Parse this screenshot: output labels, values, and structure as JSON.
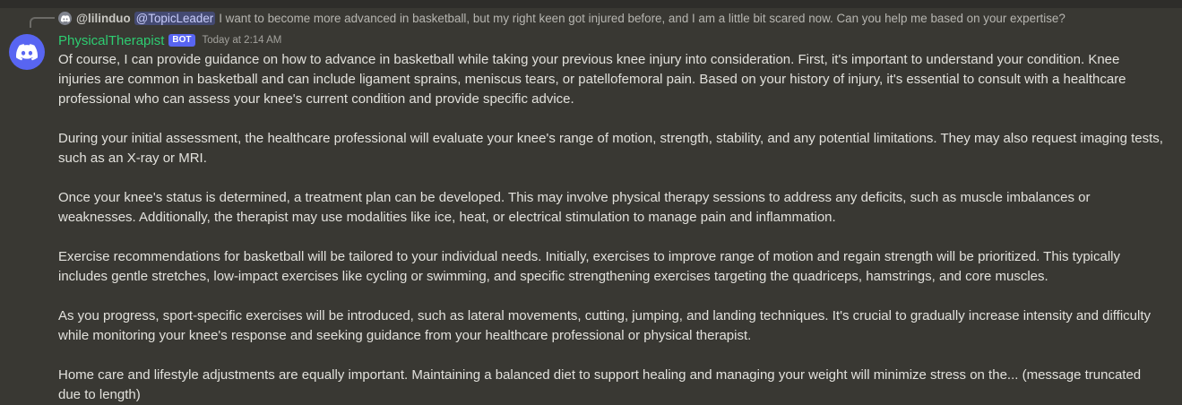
{
  "reply": {
    "username": "@lilinduo",
    "mention": "@TopicLeader",
    "text": "I want to become more advanced in basketball, but my right keen got injured before, and I am a little bit scared now. Can you help me based on your expertise?"
  },
  "message": {
    "author": "PhysicalTherapist",
    "bot_tag": "BOT",
    "timestamp": "Today at 2:14 AM",
    "paragraphs": [
      "Of course, I can provide guidance on how to advance in basketball while taking your previous knee injury into consideration. First, it's important to understand your condition. Knee injuries are common in basketball and can include ligament sprains, meniscus tears, or patellofemoral pain. Based on your history of injury, it's essential to consult with a healthcare professional who can assess your knee's current condition and provide specific advice.",
      "During your initial assessment, the healthcare professional will evaluate your knee's range of motion, strength, stability, and any potential limitations. They may also request imaging tests, such as an X-ray or MRI.",
      "Once your knee's status is determined, a treatment plan can be developed. This may involve physical therapy sessions to address any deficits, such as muscle imbalances or weaknesses. Additionally, the therapist may use modalities like ice, heat, or electrical stimulation to manage pain and inflammation.",
      "Exercise recommendations for basketball will be tailored to your individual needs. Initially, exercises to improve range of motion and regain strength will be prioritized. This typically includes gentle stretches, low-impact exercises like cycling or swimming, and specific strengthening exercises targeting the quadriceps, hamstrings, and core muscles.",
      "As you progress, sport-specific exercises will be introduced, such as lateral movements, cutting, jumping, and landing techniques. It's crucial to gradually increase intensity and difficulty while monitoring your knee's response and seeking guidance from your healthcare professional or physical therapist.",
      "Home care and lifestyle adjustments are equally important. Maintaining a balanced diet to support healing and managing your weight will minimize stress on the... (message truncated due to length)"
    ]
  },
  "colors": {
    "background": "#393833",
    "username": "#2ecc71",
    "bot_tag": "#5865f2",
    "mention_bg": "#444a72",
    "text": "#e2e1dc"
  },
  "icons": {
    "avatar": "discord-logo-icon",
    "reply_avatar": "discord-logo-icon"
  }
}
